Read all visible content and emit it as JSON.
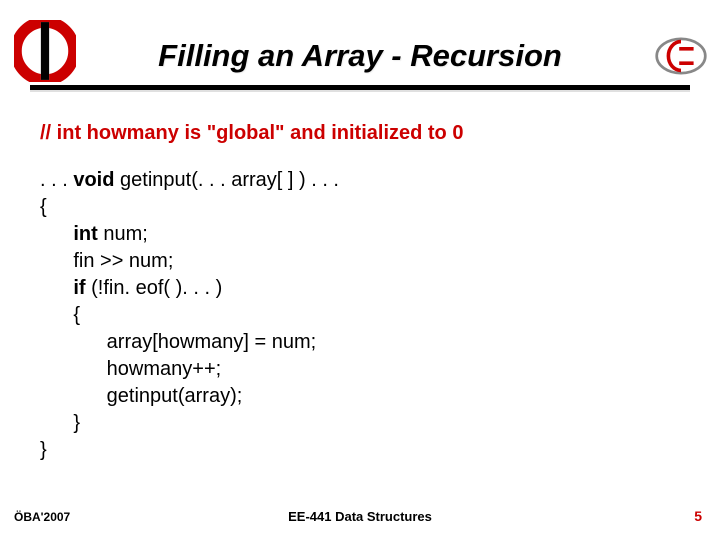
{
  "title": "Filling an Array - Recursion",
  "comment": "// int howmany is \"global\" and initialized to 0",
  "code": {
    "l1_pre": ". . . ",
    "l1_kw": "void",
    "l1_post": " getinput(. . . array[ ] ) . . .",
    "l2": "{",
    "l3_pre": "      ",
    "l3_kw": "int",
    "l3_post": " num;",
    "l4": "      fin >> num;",
    "l5_pre": "      ",
    "l5_kw": "if",
    "l5_post": " (!fin. eof( ). . . )",
    "l6": "      {",
    "l7": "            array[howmany] = num;",
    "l8": "            howmany++;",
    "l9": "            getinput(array);",
    "l10": "      }",
    "l11": "}"
  },
  "footer": {
    "left": "ÖBA'2007",
    "center": "EE-441 Data Structures",
    "page": "5"
  },
  "colors": {
    "accent_red": "#cc0000"
  }
}
